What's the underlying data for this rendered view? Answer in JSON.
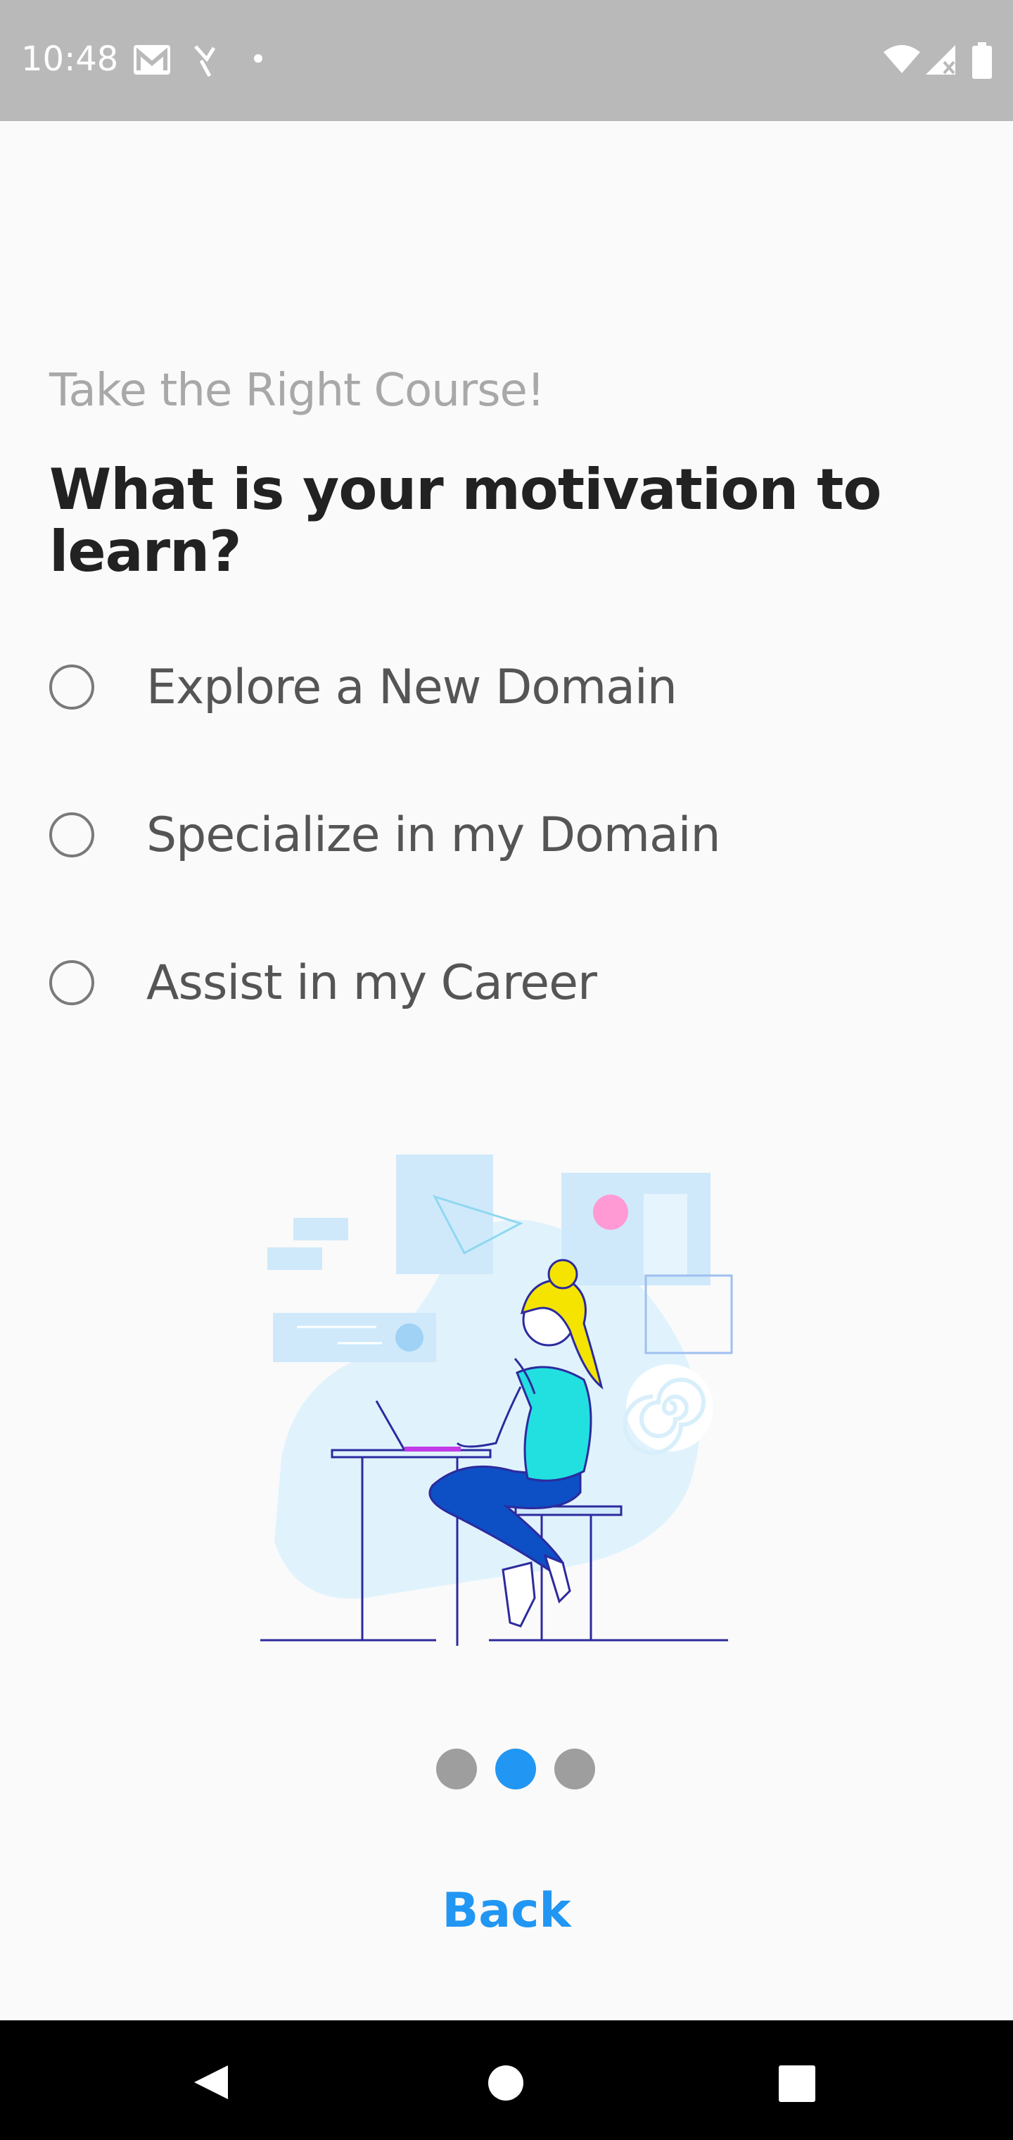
{
  "status_bar": {
    "time": "10:48",
    "icons": [
      "gmail-icon",
      "missed-call-icon",
      "dot-icon",
      "wifi-icon",
      "signal-icon",
      "battery-icon"
    ]
  },
  "content": {
    "subtitle": "Take the Right Course!",
    "question": "What is your motivation to learn?",
    "options": [
      {
        "label": "Explore a New Domain",
        "selected": false
      },
      {
        "label": "Specialize in my Domain",
        "selected": false
      },
      {
        "label": "Assist in my Career",
        "selected": false
      }
    ]
  },
  "pager": {
    "count": 3,
    "active_index": 1,
    "active_color": "#2196f3",
    "inactive_color": "#9e9e9e"
  },
  "back_label": "Back",
  "colors": {
    "accent": "#2196f3",
    "status_bar": "#b9b9b9",
    "background": "#fafafa"
  },
  "nav_bar": {
    "icons": [
      "back-triangle-icon",
      "home-circle-icon",
      "recents-square-icon"
    ]
  }
}
